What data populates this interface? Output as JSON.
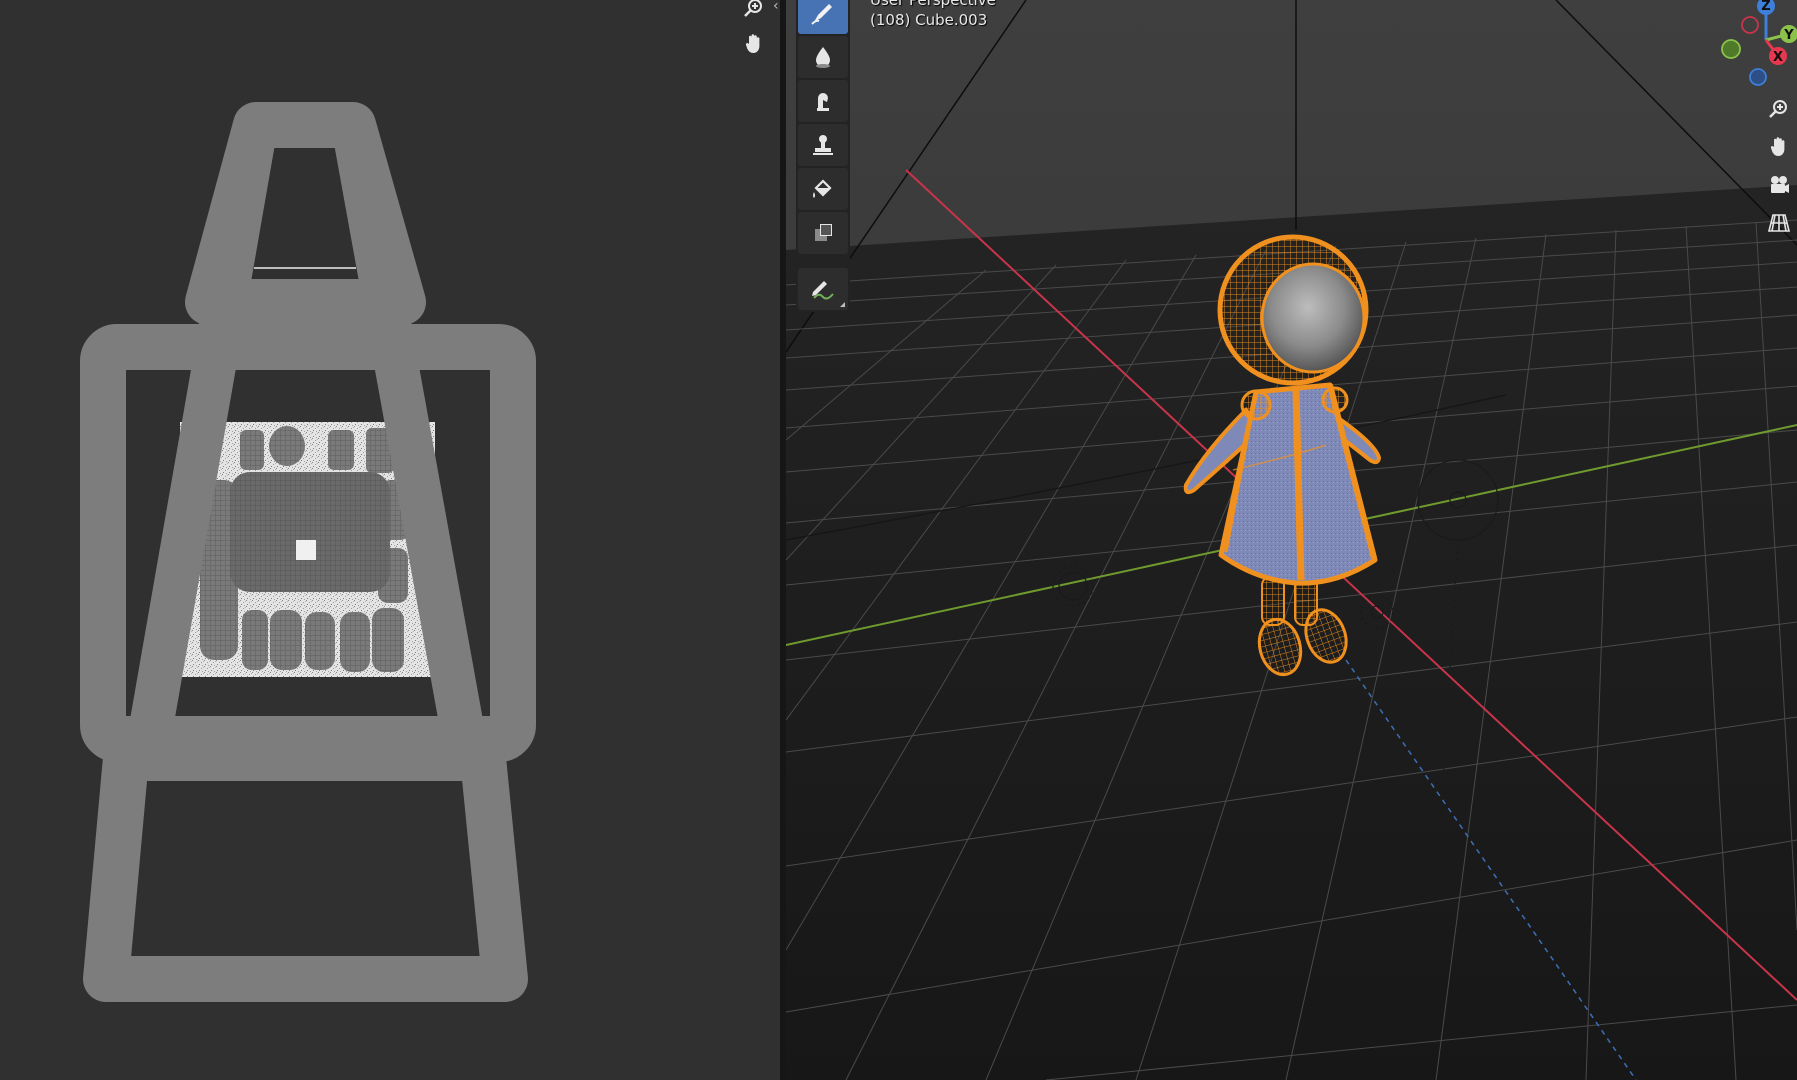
{
  "image_editor": {
    "nav_buttons": [
      {
        "name": "zoom-icon"
      },
      {
        "name": "hand-pan-icon"
      }
    ],
    "collapse_arrow": "‹"
  },
  "viewport": {
    "view_name": "User Perspective",
    "object_label": "(108) Cube.003",
    "tools": [
      {
        "name": "draw-brush-icon",
        "active": true
      },
      {
        "name": "soften-brush-icon",
        "active": false
      },
      {
        "name": "smear-brush-icon",
        "active": false
      },
      {
        "name": "clone-stamp-icon",
        "active": false
      },
      {
        "name": "fill-bucket-icon",
        "active": false
      },
      {
        "name": "mask-icon",
        "active": false
      },
      {
        "name": "annotate-icon",
        "active": false
      }
    ],
    "gizmo": {
      "x_label": "X",
      "y_label": "Y",
      "z_label": "Z",
      "x_color": "#e8384f",
      "y_color": "#8bc34a",
      "z_color": "#3d7fd9"
    },
    "nav_buttons": [
      {
        "name": "zoom-icon"
      },
      {
        "name": "hand-pan-icon"
      },
      {
        "name": "camera-view-icon"
      },
      {
        "name": "perspective-grid-icon"
      }
    ],
    "selection_color": "#f0911f",
    "axis_x_color": "#c8344a",
    "axis_y_color": "#6f9a2e"
  }
}
